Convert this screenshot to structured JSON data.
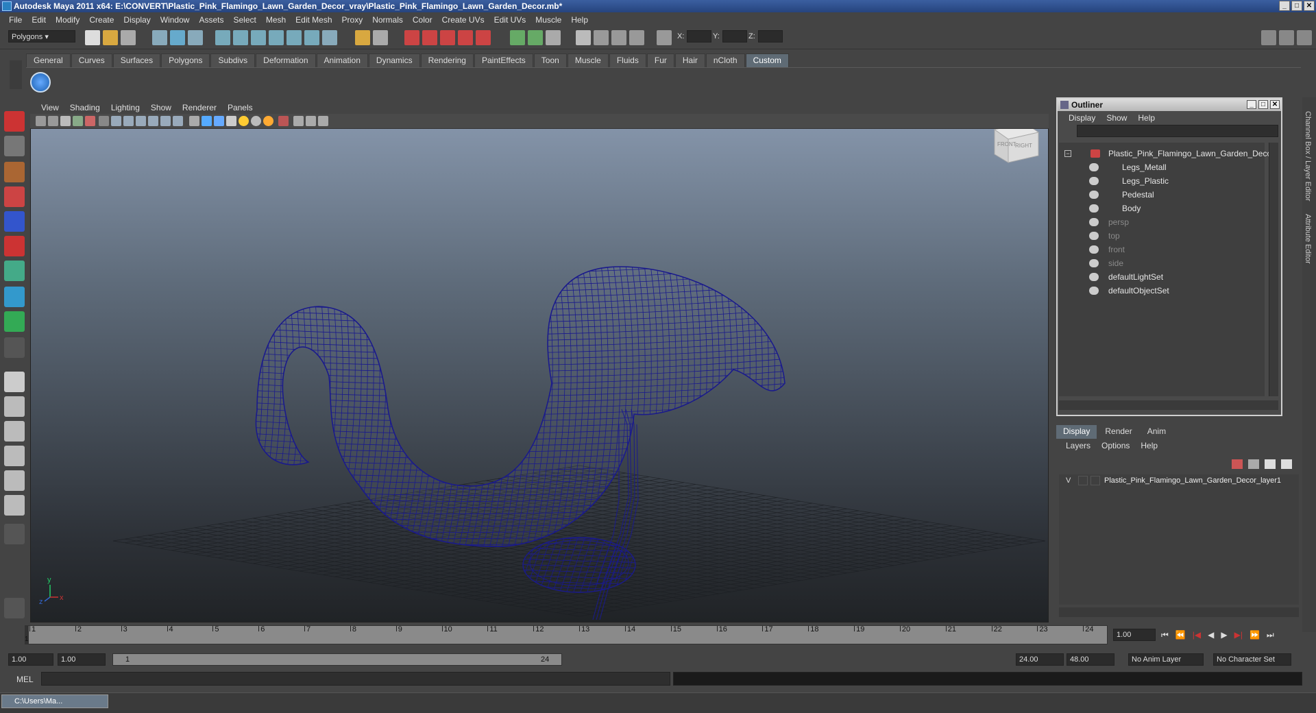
{
  "window": {
    "title": "Autodesk Maya 2011 x64: E:\\CONVERT\\Plastic_Pink_Flamingo_Lawn_Garden_Decor_vray\\Plastic_Pink_Flamingo_Lawn_Garden_Decor.mb*"
  },
  "menubar": [
    "File",
    "Edit",
    "Modify",
    "Create",
    "Display",
    "Window",
    "Assets",
    "Select",
    "Mesh",
    "Edit Mesh",
    "Proxy",
    "Normals",
    "Color",
    "Create UVs",
    "Edit UVs",
    "Muscle",
    "Help"
  ],
  "statusline": {
    "mode": "Polygons",
    "x_label": "X:",
    "y_label": "Y:",
    "z_label": "Z:"
  },
  "shelf_tabs": [
    "General",
    "Curves",
    "Surfaces",
    "Polygons",
    "Subdivs",
    "Deformation",
    "Animation",
    "Dynamics",
    "Rendering",
    "PaintEffects",
    "Toon",
    "Muscle",
    "Fluids",
    "Fur",
    "Hair",
    "nCloth",
    "Custom"
  ],
  "shelf_active": "Custom",
  "viewport": {
    "menu": [
      "View",
      "Shading",
      "Lighting",
      "Show",
      "Renderer",
      "Panels"
    ],
    "viewcube": {
      "front": "FRONT",
      "right": "RIGHT"
    },
    "axis": {
      "y": "y",
      "x": "x",
      "z": "z"
    },
    "wire_color": "#1a1a8c"
  },
  "outliner": {
    "title": "Outliner",
    "menu": [
      "Display",
      "Show",
      "Help"
    ],
    "items": [
      {
        "label": "Plastic_Pink_Flamingo_Lawn_Garden_Decor",
        "indent": 0,
        "dim": false
      },
      {
        "label": "Legs_Metall",
        "indent": 1,
        "dim": false
      },
      {
        "label": "Legs_Plastic",
        "indent": 1,
        "dim": false
      },
      {
        "label": "Pedestal",
        "indent": 1,
        "dim": false
      },
      {
        "label": "Body",
        "indent": 1,
        "dim": false
      },
      {
        "label": "persp",
        "indent": 0,
        "dim": true
      },
      {
        "label": "top",
        "indent": 0,
        "dim": true
      },
      {
        "label": "front",
        "indent": 0,
        "dim": true
      },
      {
        "label": "side",
        "indent": 0,
        "dim": true
      },
      {
        "label": "defaultLightSet",
        "indent": 0,
        "dim": false
      },
      {
        "label": "defaultObjectSet",
        "indent": 0,
        "dim": false
      }
    ]
  },
  "layer_editor": {
    "tabs": [
      "Display",
      "Render",
      "Anim"
    ],
    "menu": [
      "Layers",
      "Options",
      "Help"
    ],
    "layer": {
      "visible": "V",
      "name": "Plastic_Pink_Flamingo_Lawn_Garden_Decor_layer1"
    }
  },
  "right_strip": {
    "channel_box": "Channel Box / Layer Editor",
    "attribute_editor": "Attribute Editor"
  },
  "timeline": {
    "ticks": [
      "1",
      "2",
      "3",
      "4",
      "5",
      "6",
      "7",
      "8",
      "9",
      "10",
      "11",
      "12",
      "13",
      "14",
      "15",
      "16",
      "17",
      "18",
      "19",
      "20",
      "21",
      "22",
      "23",
      "24"
    ],
    "current_frame": "1.00",
    "current_marker": "1"
  },
  "range": {
    "start": "1.00",
    "playback_start": "1.00",
    "slider_start": "1",
    "slider_end": "24",
    "playback_end": "24.00",
    "end": "48.00",
    "anim_layer": "No Anim Layer",
    "character_set": "No Character Set"
  },
  "cmdline": {
    "label": "MEL"
  },
  "taskbar": {
    "item": "C:\\Users\\Ma..."
  }
}
